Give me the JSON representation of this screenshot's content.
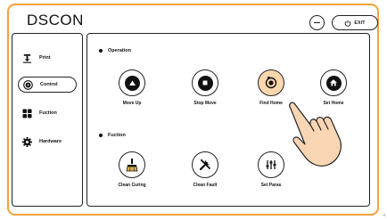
{
  "header": {
    "title": "DSCON",
    "exit_label": "EXIT"
  },
  "sidebar": {
    "items": [
      {
        "label": "Print",
        "icon": "print-icon",
        "active": false
      },
      {
        "label": "Control",
        "icon": "control-icon",
        "active": true
      },
      {
        "label": "Fuction",
        "icon": "grid-icon",
        "active": false
      },
      {
        "label": "Hardware",
        "icon": "gear-icon",
        "active": false
      }
    ]
  },
  "operation": {
    "title": "Operation",
    "buttons": [
      {
        "label": "Move Up",
        "icon": "arrow-up-icon"
      },
      {
        "label": "Stop Move",
        "icon": "stop-icon"
      },
      {
        "label": "Find Home",
        "icon": "find-home-icon",
        "highlighted": true
      },
      {
        "label": "Set Home",
        "icon": "home-icon"
      }
    ]
  },
  "fuction": {
    "title": "Fuction",
    "buttons": [
      {
        "label": "Clean Curing",
        "icon": "brush-icon"
      },
      {
        "label": "Clean Fault",
        "icon": "tools-icon"
      },
      {
        "label": "Set Paras",
        "icon": "sliders-icon"
      }
    ]
  },
  "colors": {
    "accent": "#f2a33b",
    "highlight": "#fbd7ae",
    "hand": "#f8d6b4"
  }
}
